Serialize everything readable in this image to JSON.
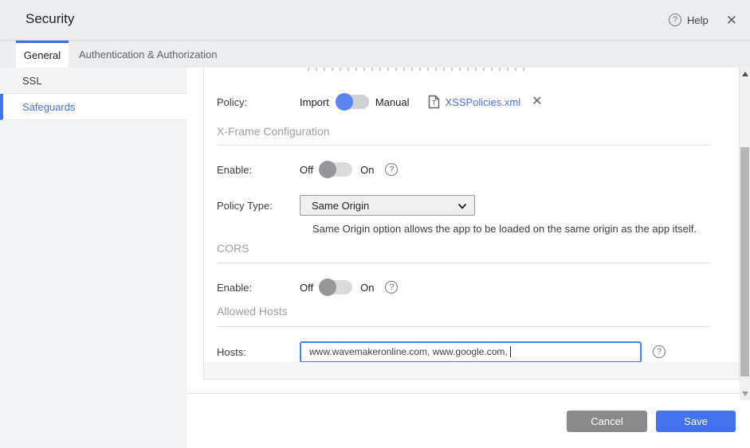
{
  "header": {
    "title": "Security",
    "help_label": "Help",
    "help_icon": "?",
    "close_icon": "✕"
  },
  "tabs": [
    {
      "label": "General",
      "active": true
    },
    {
      "label": "Authentication & Authorization",
      "active": false
    }
  ],
  "sidebar": {
    "items": [
      {
        "label": "SSL",
        "active": false
      },
      {
        "label": "Safeguards",
        "active": true
      }
    ]
  },
  "form": {
    "policy": {
      "label": "Policy:",
      "toggle_left": "Import",
      "toggle_right": "Manual",
      "toggle_state": "Import",
      "file_name": "XSSPolicies.xml",
      "remove_icon": "✕"
    },
    "xframe": {
      "heading": "X-Frame Configuration",
      "enable_label": "Enable:",
      "off_label": "Off",
      "on_label": "On",
      "enable_state": "Off",
      "help_icon": "?",
      "policy_type_label": "Policy Type:",
      "policy_type_value": "Same Origin",
      "description": "Same Origin option allows the app to be loaded on the same origin as the app itself."
    },
    "cors": {
      "heading": "CORS",
      "enable_label": "Enable:",
      "off_label": "Off",
      "on_label": "On",
      "enable_state": "Off",
      "help_icon": "?"
    },
    "allowed_hosts": {
      "heading": "Allowed Hosts",
      "hosts_label": "Hosts:",
      "hosts_value": "www.wavemakeronline.com, www.google.com, ",
      "help_icon": "?"
    }
  },
  "footer": {
    "cancel_label": "Cancel",
    "save_label": "Save"
  },
  "colors": {
    "accent_blue": "#3b6cf0",
    "link_blue": "#4a6fe0",
    "toggle_on_knob": "#5b84f3",
    "toggle_off_knob": "#95979a",
    "save_button": "#4272ee",
    "cancel_button": "#8a8a8a",
    "input_focus_border": "#4285f4",
    "sidebar_active": "#4173f2"
  }
}
